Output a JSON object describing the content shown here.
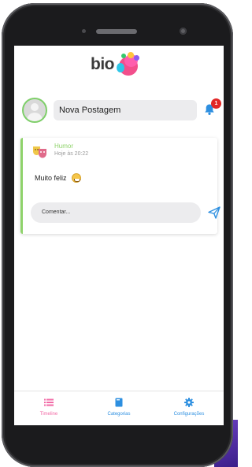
{
  "header": {
    "logo_text": "bio"
  },
  "composer": {
    "new_post_label": "Nova Postagem",
    "notification_count": "1"
  },
  "posts": [
    {
      "category": "Humor",
      "time": "Hoje às 20:22",
      "text": "Muito feliz",
      "comment_placeholder": "Comentar..."
    }
  ],
  "tabs": [
    {
      "label": "Timeline",
      "icon": "list-icon",
      "active": true
    },
    {
      "label": "Categorias",
      "icon": "book-icon",
      "active": false
    },
    {
      "label": "Configurações",
      "icon": "gear-icon",
      "active": false
    }
  ],
  "colors": {
    "accent_green": "#8fd36b",
    "timeline_pink": "#f26aa6",
    "tab_blue": "#2d8fe0",
    "badge_red": "#e22727"
  }
}
